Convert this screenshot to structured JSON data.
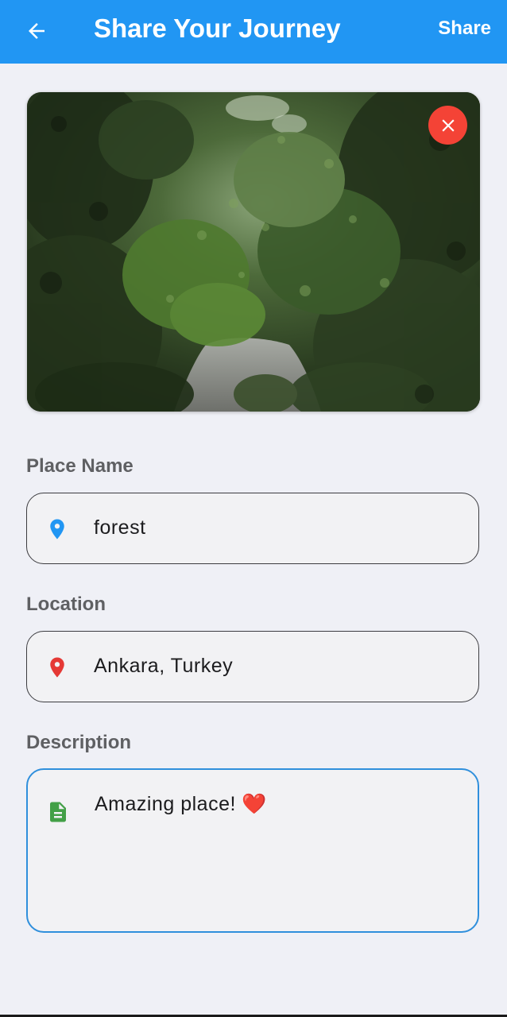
{
  "app_bar": {
    "title": "Share Your Journey",
    "share_label": "Share",
    "back_icon": "arrow-left-icon"
  },
  "photo": {
    "remove_icon": "close-icon",
    "colors": {
      "remove_button": "#f44336"
    }
  },
  "form": {
    "place_name": {
      "label": "Place Name",
      "value": "forest",
      "icon": "location-pin-icon",
      "icon_color": "#2196f3"
    },
    "location": {
      "label": "Location",
      "value": "Ankara, Turkey",
      "icon": "location-pin-icon",
      "icon_color": "#e53935"
    },
    "description": {
      "label": "Description",
      "value": "Amazing place! ❤️",
      "icon": "document-icon",
      "icon_color": "#43a047",
      "focused": true
    }
  },
  "colors": {
    "primary": "#2196f3",
    "background": "#eff0f6",
    "focus_border": "#2f8fdc"
  }
}
